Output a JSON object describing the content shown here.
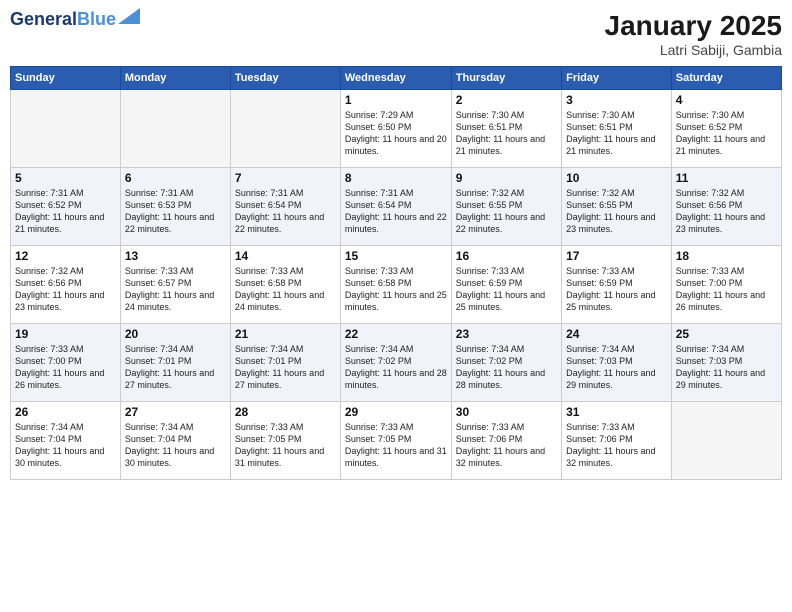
{
  "logo": {
    "line1": "General",
    "line2": "Blue"
  },
  "header": {
    "title": "January 2025",
    "subtitle": "Latri Sabiji, Gambia"
  },
  "weekdays": [
    "Sunday",
    "Monday",
    "Tuesday",
    "Wednesday",
    "Thursday",
    "Friday",
    "Saturday"
  ],
  "weeks": [
    [
      {
        "day": "",
        "info": ""
      },
      {
        "day": "",
        "info": ""
      },
      {
        "day": "",
        "info": ""
      },
      {
        "day": "1",
        "info": "Sunrise: 7:29 AM\nSunset: 6:50 PM\nDaylight: 11 hours and 20 minutes."
      },
      {
        "day": "2",
        "info": "Sunrise: 7:30 AM\nSunset: 6:51 PM\nDaylight: 11 hours and 21 minutes."
      },
      {
        "day": "3",
        "info": "Sunrise: 7:30 AM\nSunset: 6:51 PM\nDaylight: 11 hours and 21 minutes."
      },
      {
        "day": "4",
        "info": "Sunrise: 7:30 AM\nSunset: 6:52 PM\nDaylight: 11 hours and 21 minutes."
      }
    ],
    [
      {
        "day": "5",
        "info": "Sunrise: 7:31 AM\nSunset: 6:52 PM\nDaylight: 11 hours and 21 minutes."
      },
      {
        "day": "6",
        "info": "Sunrise: 7:31 AM\nSunset: 6:53 PM\nDaylight: 11 hours and 22 minutes."
      },
      {
        "day": "7",
        "info": "Sunrise: 7:31 AM\nSunset: 6:54 PM\nDaylight: 11 hours and 22 minutes."
      },
      {
        "day": "8",
        "info": "Sunrise: 7:31 AM\nSunset: 6:54 PM\nDaylight: 11 hours and 22 minutes."
      },
      {
        "day": "9",
        "info": "Sunrise: 7:32 AM\nSunset: 6:55 PM\nDaylight: 11 hours and 22 minutes."
      },
      {
        "day": "10",
        "info": "Sunrise: 7:32 AM\nSunset: 6:55 PM\nDaylight: 11 hours and 23 minutes."
      },
      {
        "day": "11",
        "info": "Sunrise: 7:32 AM\nSunset: 6:56 PM\nDaylight: 11 hours and 23 minutes."
      }
    ],
    [
      {
        "day": "12",
        "info": "Sunrise: 7:32 AM\nSunset: 6:56 PM\nDaylight: 11 hours and 23 minutes."
      },
      {
        "day": "13",
        "info": "Sunrise: 7:33 AM\nSunset: 6:57 PM\nDaylight: 11 hours and 24 minutes."
      },
      {
        "day": "14",
        "info": "Sunrise: 7:33 AM\nSunset: 6:58 PM\nDaylight: 11 hours and 24 minutes."
      },
      {
        "day": "15",
        "info": "Sunrise: 7:33 AM\nSunset: 6:58 PM\nDaylight: 11 hours and 25 minutes."
      },
      {
        "day": "16",
        "info": "Sunrise: 7:33 AM\nSunset: 6:59 PM\nDaylight: 11 hours and 25 minutes."
      },
      {
        "day": "17",
        "info": "Sunrise: 7:33 AM\nSunset: 6:59 PM\nDaylight: 11 hours and 25 minutes."
      },
      {
        "day": "18",
        "info": "Sunrise: 7:33 AM\nSunset: 7:00 PM\nDaylight: 11 hours and 26 minutes."
      }
    ],
    [
      {
        "day": "19",
        "info": "Sunrise: 7:33 AM\nSunset: 7:00 PM\nDaylight: 11 hours and 26 minutes."
      },
      {
        "day": "20",
        "info": "Sunrise: 7:34 AM\nSunset: 7:01 PM\nDaylight: 11 hours and 27 minutes."
      },
      {
        "day": "21",
        "info": "Sunrise: 7:34 AM\nSunset: 7:01 PM\nDaylight: 11 hours and 27 minutes."
      },
      {
        "day": "22",
        "info": "Sunrise: 7:34 AM\nSunset: 7:02 PM\nDaylight: 11 hours and 28 minutes."
      },
      {
        "day": "23",
        "info": "Sunrise: 7:34 AM\nSunset: 7:02 PM\nDaylight: 11 hours and 28 minutes."
      },
      {
        "day": "24",
        "info": "Sunrise: 7:34 AM\nSunset: 7:03 PM\nDaylight: 11 hours and 29 minutes."
      },
      {
        "day": "25",
        "info": "Sunrise: 7:34 AM\nSunset: 7:03 PM\nDaylight: 11 hours and 29 minutes."
      }
    ],
    [
      {
        "day": "26",
        "info": "Sunrise: 7:34 AM\nSunset: 7:04 PM\nDaylight: 11 hours and 30 minutes."
      },
      {
        "day": "27",
        "info": "Sunrise: 7:34 AM\nSunset: 7:04 PM\nDaylight: 11 hours and 30 minutes."
      },
      {
        "day": "28",
        "info": "Sunrise: 7:33 AM\nSunset: 7:05 PM\nDaylight: 11 hours and 31 minutes."
      },
      {
        "day": "29",
        "info": "Sunrise: 7:33 AM\nSunset: 7:05 PM\nDaylight: 11 hours and 31 minutes."
      },
      {
        "day": "30",
        "info": "Sunrise: 7:33 AM\nSunset: 7:06 PM\nDaylight: 11 hours and 32 minutes."
      },
      {
        "day": "31",
        "info": "Sunrise: 7:33 AM\nSunset: 7:06 PM\nDaylight: 11 hours and 32 minutes."
      },
      {
        "day": "",
        "info": ""
      }
    ]
  ]
}
